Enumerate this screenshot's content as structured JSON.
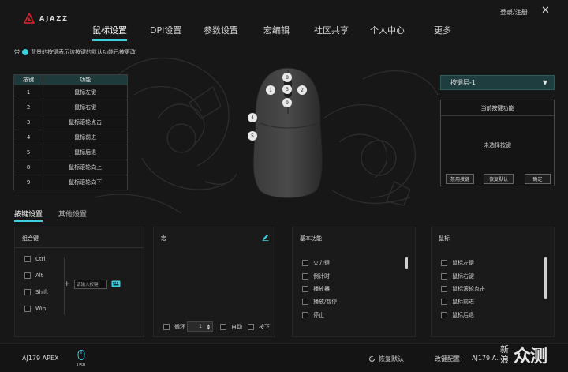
{
  "brand": {
    "logo_text": "AJAZZ",
    "accent": "#39d0e0",
    "brand_red": "#d0242b"
  },
  "header": {
    "tabs": [
      "鼠标设置",
      "DPI设置",
      "参数设置",
      "宏编辑",
      "社区共享",
      "个人中心",
      "更多"
    ],
    "active_tab": 0,
    "login": "登录/注册",
    "close_icon": "close-icon"
  },
  "hint": {
    "prefix": "带",
    "text": "背景的按键表示该按键的默认功能已被更改"
  },
  "key_table": {
    "headers": [
      "按键",
      "功能"
    ],
    "rows": [
      [
        "1",
        "鼠标左键"
      ],
      [
        "2",
        "鼠标右键"
      ],
      [
        "3",
        "鼠标滚轮点击"
      ],
      [
        "4",
        "鼠标前进"
      ],
      [
        "5",
        "鼠标后退"
      ],
      [
        "8",
        "鼠标滚轮向上"
      ],
      [
        "9",
        "鼠标滚轮向下"
      ]
    ]
  },
  "mouse_buttons": [
    "8",
    "1",
    "3",
    "2",
    "9",
    "4",
    "5"
  ],
  "right_panel": {
    "layer": "按键层-1",
    "current_func_title": "当前按键功能",
    "empty_text": "未选择按键",
    "buttons": [
      "禁用按键",
      "恢复默认",
      "确定"
    ]
  },
  "sub_tabs": [
    "按键设置",
    "其他设置"
  ],
  "combo_panel": {
    "title": "组合键",
    "keys": [
      "Ctrl",
      "Alt",
      "Shift",
      "Win"
    ],
    "plus": "+",
    "input_placeholder": "请输入按键",
    "keyboard_icon": "keyboard-icon"
  },
  "macro_panel": {
    "title": "宏",
    "edit_icon": "pencil-icon",
    "loop_label": "循环",
    "loop_value": "1",
    "auto_label": "自动",
    "press_label": "按下"
  },
  "basic_panel": {
    "title": "基本功能",
    "items": [
      "火力键",
      "倒计时",
      "播放器",
      "播放/暂停",
      "停止"
    ]
  },
  "mouse_panel": {
    "title": "鼠标",
    "items": [
      "鼠标左键",
      "鼠标右键",
      "鼠标滚轮点击",
      "鼠标前进",
      "鼠标后退"
    ]
  },
  "bottom": {
    "device": "AJ179 APEX",
    "usb_label": "USB",
    "restore": "恢复默认",
    "config_label": "改键配置:",
    "config_value": "AJ179 A..."
  },
  "watermark": {
    "small": "新浪",
    "big": "众测"
  }
}
